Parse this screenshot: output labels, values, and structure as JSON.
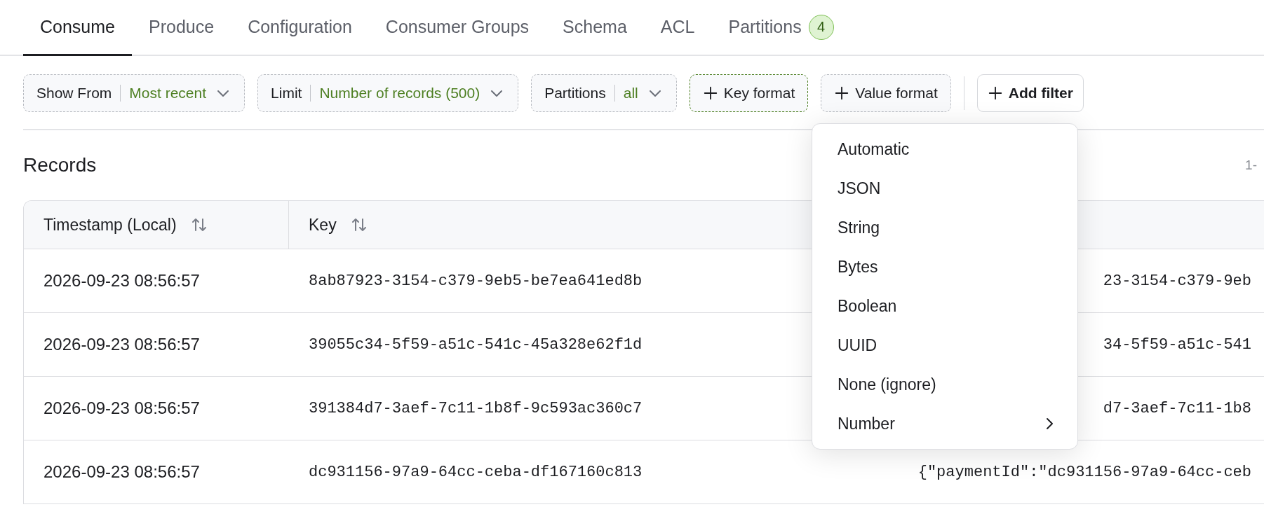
{
  "tabs": [
    {
      "label": "Consume",
      "selected": true
    },
    {
      "label": "Produce",
      "selected": false
    },
    {
      "label": "Configuration",
      "selected": false
    },
    {
      "label": "Consumer Groups",
      "selected": false
    },
    {
      "label": "Schema",
      "selected": false
    },
    {
      "label": "ACL",
      "selected": false
    },
    {
      "label": "Partitions",
      "selected": false,
      "badge": "4"
    }
  ],
  "filters": [
    {
      "kind": "select",
      "label": "Show From",
      "value": "Most recent"
    },
    {
      "kind": "select",
      "label": "Limit",
      "value": "Number of records (500)"
    },
    {
      "kind": "select",
      "label": "Partitions",
      "value": "all"
    },
    {
      "kind": "add",
      "label": "Key format",
      "active": true
    },
    {
      "kind": "add",
      "label": "Value format",
      "active": false
    },
    {
      "kind": "button",
      "label": "Add filter"
    }
  ],
  "records": {
    "title": "Records",
    "pagination": "1-",
    "columns": [
      "Timestamp (Local)",
      "Key"
    ],
    "rows": [
      {
        "timestamp": "2026-09-23 08:56:57",
        "key": "8ab87923-3154-c379-9eb5-be7ea641ed8b",
        "column_3": "23-3154-c379-9eb"
      },
      {
        "timestamp": "2026-09-23 08:56:57",
        "key": "39055c34-5f59-a51c-541c-45a328e62f1d",
        "column_3": "34-5f59-a51c-541"
      },
      {
        "timestamp": "2026-09-23 08:56:57",
        "key": "391384d7-3aef-7c11-1b8f-9c593ac360c7",
        "column_3": "d7-3aef-7c11-1b8"
      },
      {
        "timestamp": "2026-09-23 08:56:57",
        "key": "dc931156-97a9-64cc-ceba-df167160c813",
        "column_3": "{\"paymentId\":\"dc931156-97a9-64cc-ceb"
      }
    ]
  },
  "key_format_menu": [
    {
      "kind": "option",
      "label": "Automatic"
    },
    {
      "kind": "option",
      "label": "JSON"
    },
    {
      "kind": "option",
      "label": "String"
    },
    {
      "kind": "option",
      "label": "Bytes"
    },
    {
      "kind": "option",
      "label": "Boolean"
    },
    {
      "kind": "option",
      "label": "UUID"
    },
    {
      "kind": "option",
      "label": "None (ignore)"
    },
    {
      "kind": "submenu",
      "label": "Number"
    }
  ]
}
